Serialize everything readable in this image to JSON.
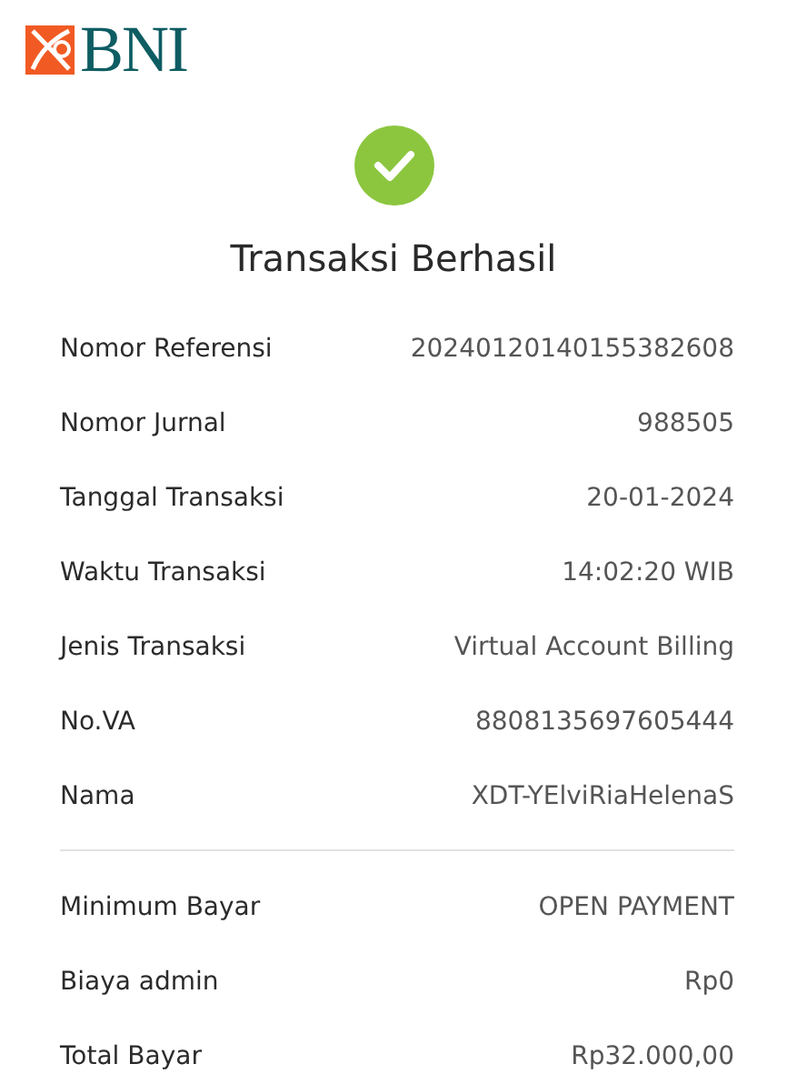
{
  "logo": {
    "text": "BNI"
  },
  "title": "Transaksi Berhasil",
  "details": [
    {
      "label": "Nomor Referensi",
      "value": "20240120140155382608"
    },
    {
      "label": "Nomor Jurnal",
      "value": "988505"
    },
    {
      "label": "Tanggal Transaksi",
      "value": "20-01-2024"
    },
    {
      "label": "Waktu Transaksi",
      "value": "14:02:20 WIB"
    },
    {
      "label": "Jenis Transaksi",
      "value": "Virtual Account Billing"
    },
    {
      "label": "No.VA",
      "value": "8808135697605444"
    },
    {
      "label": "Nama",
      "value": "XDT-YElviRiaHelenaS"
    }
  ],
  "summary": [
    {
      "label": "Minimum Bayar",
      "value": "OPEN PAYMENT"
    },
    {
      "label": "Biaya admin",
      "value": "Rp0"
    },
    {
      "label": "Total Bayar",
      "value": "Rp32.000,00"
    }
  ]
}
